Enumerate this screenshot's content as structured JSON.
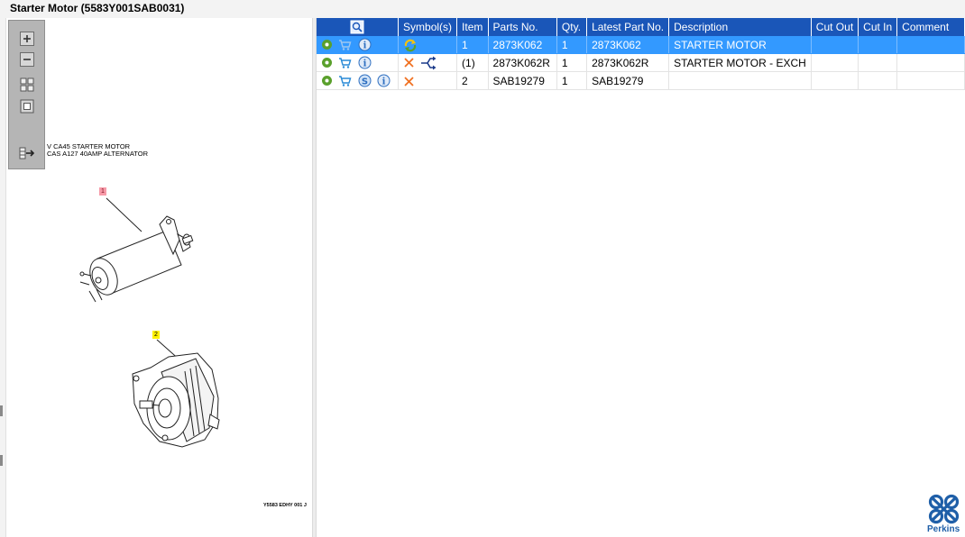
{
  "window": {
    "title": "Starter Motor (5583Y001SAB0031)"
  },
  "toolbox": {
    "buttons": [
      {
        "name": "zoom-in-icon"
      },
      {
        "name": "zoom-out-icon"
      },
      {
        "name": "fit-all-icon"
      },
      {
        "name": "actual-size-icon"
      },
      {
        "name": "export-icon"
      }
    ]
  },
  "illustration": {
    "caption_line1": "V CA45 STARTER MOTOR",
    "caption_line2": "CAS A127 40AMP ALTERNATOR",
    "callout_1": "1",
    "callout_2": "2",
    "drawing_ref": "Y5583 EDHY 001 J"
  },
  "grid": {
    "columns": [
      "",
      "Symbol(s)",
      "Item",
      "Parts No.",
      "Qty.",
      "Latest Part No.",
      "Description",
      "Cut Out",
      "Cut In",
      "Comment"
    ],
    "rows": [
      {
        "item": "1",
        "parts_no": "2873K062",
        "qty": "1",
        "latest_part_no": "2873K062",
        "description": "STARTER MOTOR",
        "cut_out": "",
        "cut_in": "",
        "comment": "",
        "selected": true,
        "icons": [
          "gear-icon",
          "cart-icon",
          "info-icon"
        ],
        "symbols": [
          "refresh-arrows-icon"
        ]
      },
      {
        "item": "(1)",
        "parts_no": "2873K062R",
        "qty": "1",
        "latest_part_no": "2873K062R",
        "description": "STARTER MOTOR - EXCH",
        "cut_out": "",
        "cut_in": "",
        "comment": "",
        "selected": false,
        "icons": [
          "gear-icon",
          "cart-icon",
          "info-icon"
        ],
        "symbols": [
          "cross-icon",
          "branch-arrow-icon"
        ]
      },
      {
        "item": "2",
        "parts_no": "SAB19279",
        "qty": "1",
        "latest_part_no": "SAB19279",
        "description": "",
        "cut_out": "",
        "cut_in": "",
        "comment": "",
        "selected": false,
        "icons": [
          "gear-icon",
          "cart-icon",
          "service-icon",
          "info-icon"
        ],
        "symbols": [
          "cross-icon"
        ]
      }
    ]
  },
  "brand": {
    "name": "Perkins"
  },
  "colors": {
    "header_blue": "#1a56b8",
    "selection_blue": "#3399ff",
    "brand_blue": "#1f5fa8",
    "cross_orange": "#f07020",
    "gear_green": "#5aa02c"
  }
}
